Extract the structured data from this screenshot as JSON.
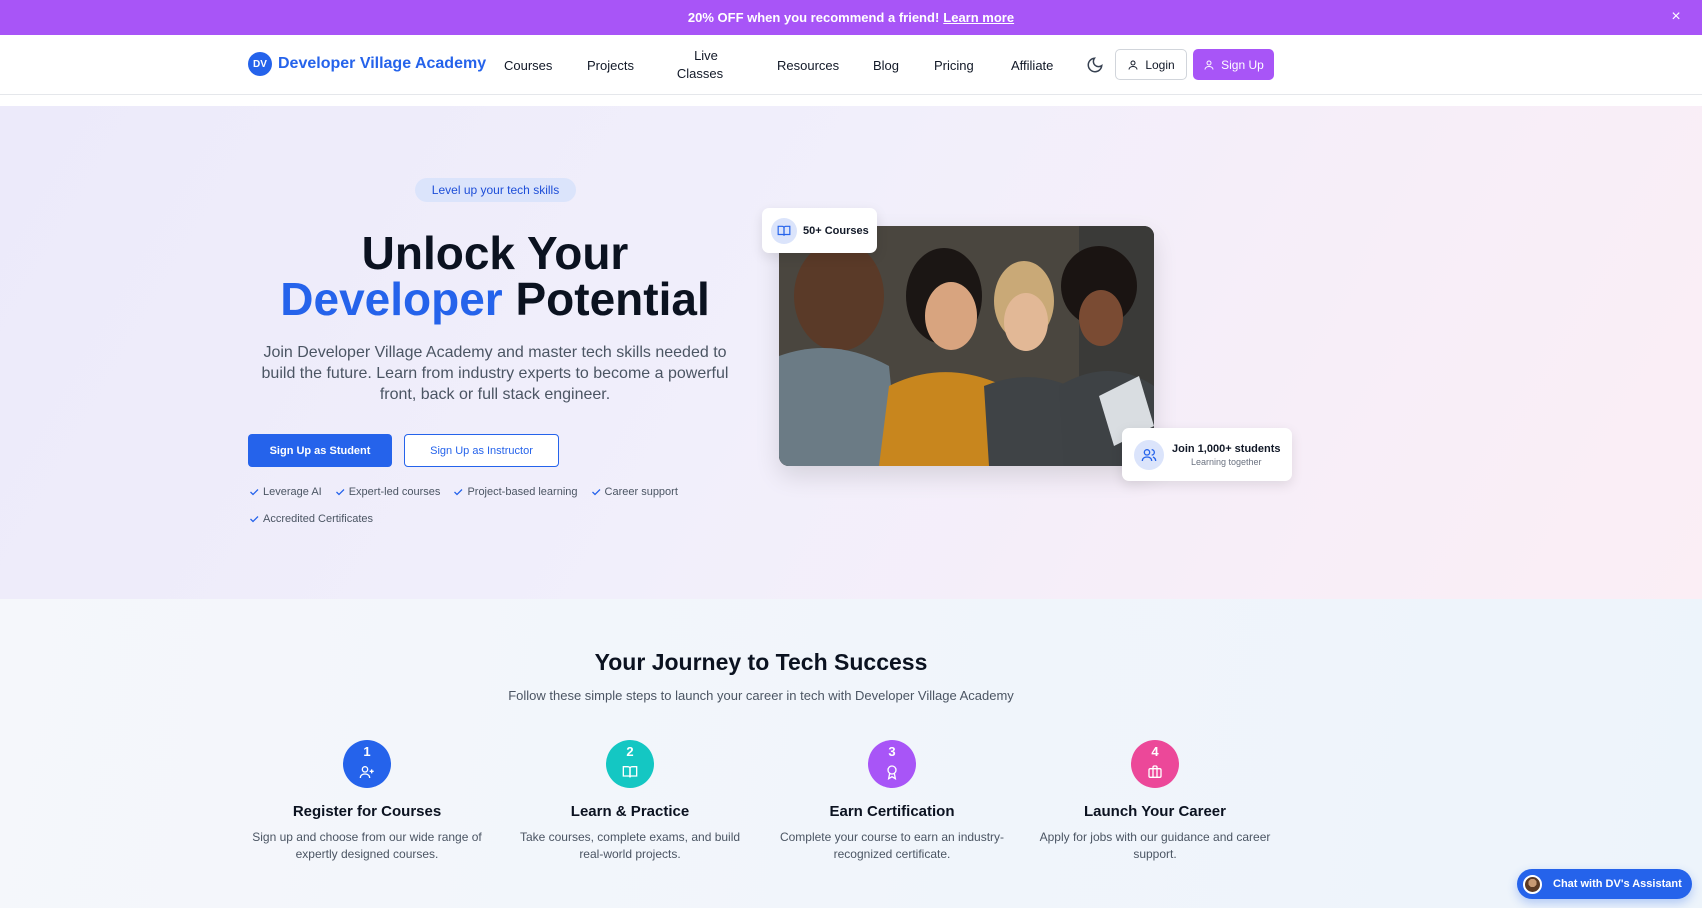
{
  "promo": {
    "text": "20% OFF when you recommend a friend!",
    "link": "Learn more",
    "close_icon": "×"
  },
  "nav": {
    "logo_initials": "DV",
    "brand": "Developer Village Academy",
    "links": [
      "Courses",
      "Projects",
      "Resources",
      "Blog",
      "Pricing",
      "Affiliate"
    ],
    "live_line1": "Live",
    "live_line2": "Classes",
    "login": "Login",
    "signup": "Sign Up",
    "theme_icon": "moon-icon"
  },
  "hero": {
    "pill": "Level up your tech skills",
    "title_line1": "Unlock Your",
    "title_highlight": "Developer",
    "title_rest": " Potential",
    "lead": "Join Developer Village Academy and master tech skills needed to build the future. Learn from industry experts to become a powerful front, back or full stack engineer.",
    "cta_student": "Sign Up as Student",
    "cta_instructor": "Sign Up as Instructor",
    "features": [
      "Leverage AI",
      "Expert-led courses",
      "Project-based learning",
      "Career support",
      "Accredited Certificates"
    ],
    "badge_courses": "50+ Courses",
    "badge_students_title": "Join 1,000+ students",
    "badge_students_sub": "Learning together"
  },
  "journey": {
    "title": "Your Journey to Tech Success",
    "subtitle": "Follow these simple steps to launch your career in tech with Developer Village Academy",
    "steps": [
      {
        "num": "1",
        "title": "Register for Courses",
        "desc": "Sign up and choose from our wide range of expertly designed courses.",
        "color": "#2563eb",
        "icon": "user-plus-icon"
      },
      {
        "num": "2",
        "title": "Learn & Practice",
        "desc": "Take courses, complete exams, and build real-world projects.",
        "color": "#14c7c3",
        "icon": "book-open-icon"
      },
      {
        "num": "3",
        "title": "Earn Certification",
        "desc": "Complete your course to earn an industry-recognized certificate.",
        "color": "#a855f7",
        "icon": "award-icon"
      },
      {
        "num": "4",
        "title": "Launch Your Career",
        "desc": "Apply for jobs with our guidance and career support.",
        "color": "#ec4899",
        "icon": "briefcase-icon"
      }
    ]
  },
  "chat": {
    "label": "Chat with DV's Assistant"
  },
  "colors": {
    "primary": "#2563eb",
    "purple": "#a855f7"
  }
}
